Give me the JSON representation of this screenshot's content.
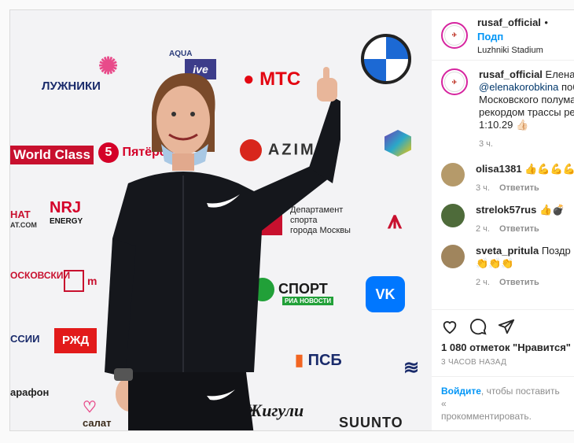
{
  "header": {
    "username": "rusaf_official",
    "dot": "•",
    "follow_label": "Подп",
    "location": "Luzhniki Stadium"
  },
  "caption": {
    "username": "rusaf_official",
    "line1": "Елена",
    "mention": "@elenakorobkina",
    "line2_rest": "поб",
    "line3": "Московского полума",
    "line4": "рекордом трассы ре",
    "line5": "1:10.29 👍🏻",
    "time": "3 ч."
  },
  "comments": [
    {
      "username": "olisa1381",
      "text": "👍💪💪💪",
      "time": "3 ч.",
      "reply": "Ответить",
      "color": "#b59a6a"
    },
    {
      "username": "strelok57rus",
      "text": "👍💣",
      "time": "2 ч.",
      "reply": "Ответить",
      "color": "#4e6b3a"
    },
    {
      "username": "sveta_pritula",
      "text": "Поздр",
      "text2": "👏👏👏",
      "time": "2 ч.",
      "reply": "Ответить",
      "color": "#a0855d"
    }
  ],
  "actions": {
    "likes": "1 080 отметок \"Нравится\"",
    "timestamp": "3 ЧАСОВ НАЗАД"
  },
  "login": {
    "link": "Войдите",
    "text": ", чтобы поставить «",
    "line2": "прокомментировать."
  },
  "wall_logos": {
    "luzhniki": "ЛУЖНИКИ",
    "mts": "МТС",
    "bmw": "BMW",
    "world_class": "World Class",
    "pyat": "Пятёрочка",
    "azimut": "AZIMUT",
    "energy": "ENERGY",
    "dept_line1": "Департамент",
    "dept_line2": "спорта",
    "dept_line3": "города Москвы",
    "sport": "СПОРТ",
    "ria": "РИА НОВОСТИ",
    "vk": "VK",
    "rzd": "РЖД",
    "psb": "ПСБ",
    "zhiguli": "Жигули",
    "suunto": "SUUNTO",
    "marathon": "арафон",
    "salat": "салат",
    "moskovsky": "ОСКОВСКИЙ",
    "ssii": "ССИИ",
    "aqua": "AQUA",
    "hat": "HAT",
    "hat2": "AT.COM",
    "m": "m"
  }
}
